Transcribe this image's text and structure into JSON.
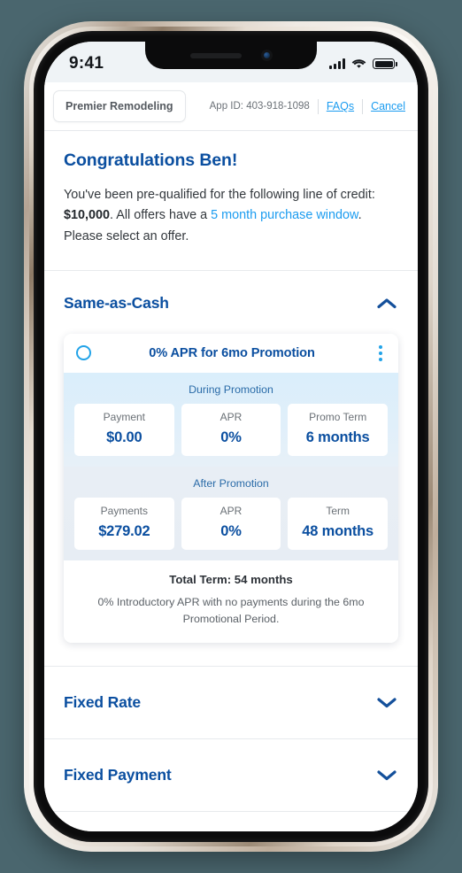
{
  "status_bar": {
    "time": "9:41",
    "signal_icon": "cellular-bars-icon",
    "wifi_icon": "wifi-icon",
    "battery_icon": "battery-full-icon"
  },
  "header": {
    "brand_label": "Premier Remodeling",
    "app_id": "App ID: 403-918-1098",
    "faqs_label": "FAQs",
    "cancel_label": "Cancel"
  },
  "intro": {
    "heading": "Congratulations Ben!",
    "body_part1": "You've been pre-qualified for the following line of credit: ",
    "credit_amount": "$10,000",
    "body_part2": ". All offers have a ",
    "purchase_window": "5 month purchase window",
    "body_part3": ". Please select an offer."
  },
  "sections": [
    {
      "id": "same-as-cash",
      "title": "Same-as-Cash",
      "expanded": true,
      "chevron_icon": "chevron-up-icon"
    },
    {
      "id": "fixed-rate",
      "title": "Fixed Rate",
      "expanded": false,
      "chevron_icon": "chevron-down-icon"
    },
    {
      "id": "fixed-payment",
      "title": "Fixed Payment",
      "expanded": false,
      "chevron_icon": "chevron-down-icon"
    }
  ],
  "offer_card": {
    "selected": false,
    "radio_icon": "radio-unchecked-icon",
    "title": "0% APR for 6mo Promotion",
    "menu_icon": "kebab-menu-icon",
    "during": {
      "label": "During Promotion",
      "metrics": [
        {
          "label": "Payment",
          "value": "$0.00"
        },
        {
          "label": "APR",
          "value": "0%"
        },
        {
          "label": "Promo Term",
          "value": "6 months"
        }
      ]
    },
    "after": {
      "label": "After Promotion",
      "metrics": [
        {
          "label": "Payments",
          "value": "$279.02"
        },
        {
          "label": "APR",
          "value": "0%"
        },
        {
          "label": "Term",
          "value": "48 months"
        }
      ]
    },
    "total_term": "Total Term: 54 months",
    "disclaimer": "0% Introductory APR with no payments during the 6mo Promotional Period."
  },
  "colors": {
    "brand_navy": "#0b4fa0",
    "link_blue": "#1b9cf0",
    "accent_cyan": "#22a3e8",
    "page_background": "#4a666e"
  }
}
